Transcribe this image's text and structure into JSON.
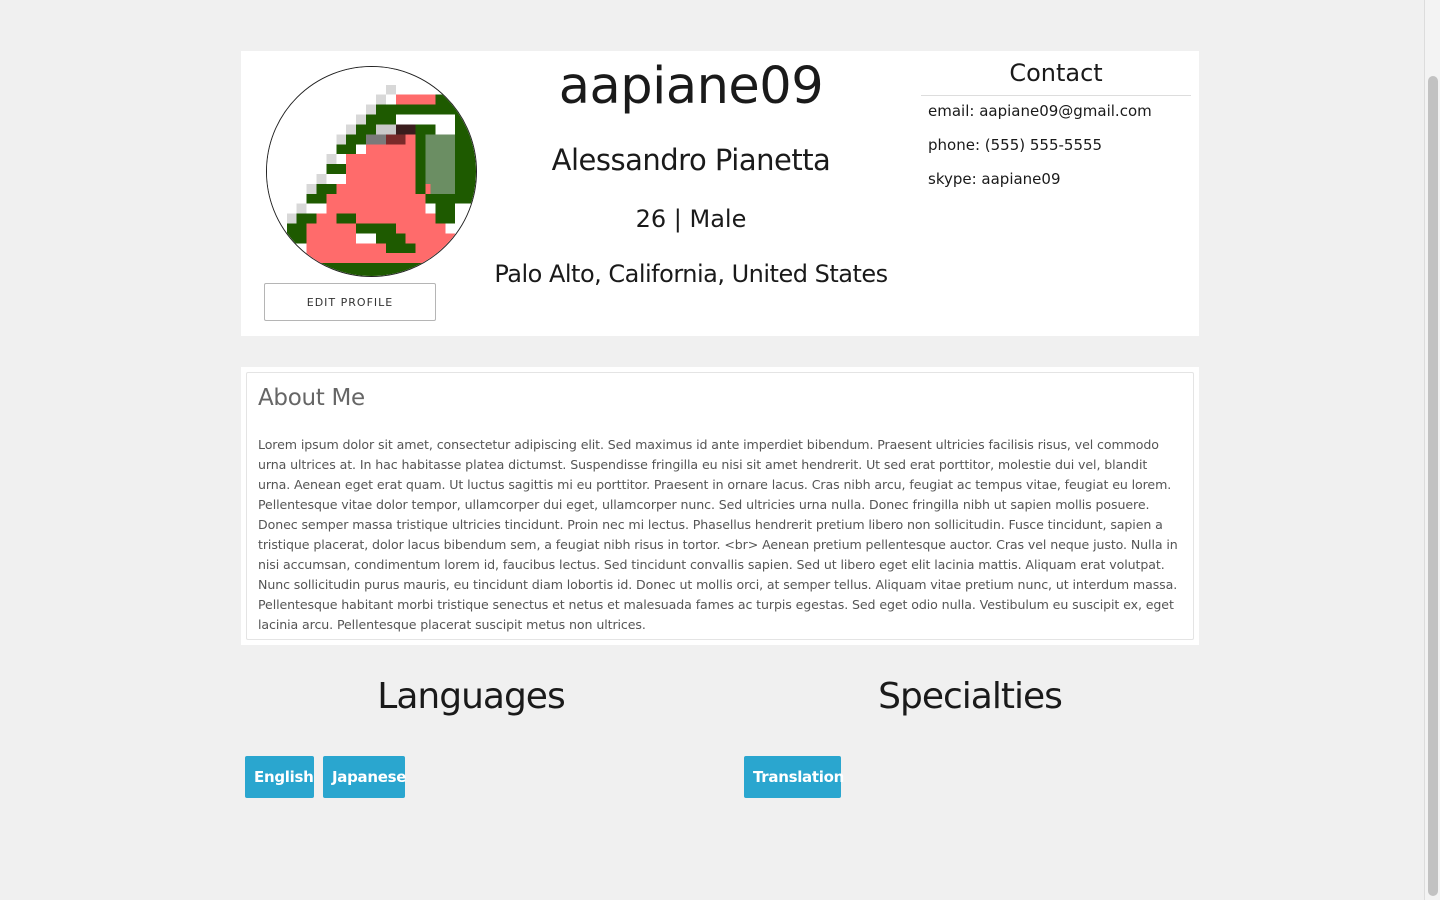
{
  "profile": {
    "username": "aapiane09",
    "full_name": "Alessandro Pianetta",
    "age_sex": "26 | Male",
    "location": "Palo Alto, California, United States",
    "edit_button": "EDIT PROFILE",
    "avatar_icon": "pixel-bird-avatar"
  },
  "contact": {
    "title": "Contact",
    "email": "email: aapiane09@gmail.com",
    "phone": "phone: (555) 555-5555",
    "skype": "skype: aapiane09"
  },
  "about": {
    "title": "About Me",
    "text": "Lorem ipsum dolor sit amet, consectetur adipiscing elit. Sed maximus id ante imperdiet bibendum. Praesent ultricies facilisis risus, vel commodo urna ultrices at. In hac habitasse platea dictumst. Suspendisse fringilla eu nisi sit amet hendrerit. Ut sed erat porttitor, molestie dui vel, blandit urna. Aenean eget erat quam. Ut luctus sagittis mi eu porttitor. Praesent in ornare lacus. Cras nibh arcu, feugiat ac tempus vitae, feugiat eu lorem. Pellentesque vitae dolor tempor, ullamcorper dui eget, ullamcorper nunc. Sed ultricies urna nulla. Donec fringilla nibh ut sapien mollis posuere. Donec semper massa tristique ultricies tincidunt. Proin nec mi lectus. Phasellus hendrerit pretium libero non sollicitudin. Fusce tincidunt, sapien a tristique placerat, dolor lacus bibendum sem, a feugiat nibh risus in tortor. <br> Aenean pretium pellentesque auctor. Cras vel neque justo. Nulla in nisi accumsan, condimentum lorem id, faucibus lectus. Sed tincidunt convallis sapien. Sed ut libero eget elit lacinia mattis. Aliquam erat volutpat. Nunc sollicitudin purus mauris, eu tincidunt diam lobortis id. Donec ut mollis orci, at semper tellus. Aliquam vitae pretium nunc, ut interdum massa. Pellentesque habitant morbi tristique senectus et netus et malesuada fames ac turpis egestas. Sed eget odio nulla. Vestibulum eu suscipit ex, eget lacinia arcu. Pellentesque placerat suscipit metus non ultrices."
  },
  "languages": {
    "title": "Languages",
    "items": [
      "English",
      "Japanese"
    ]
  },
  "specialties": {
    "title": "Specialties",
    "items": [
      "Translation"
    ]
  },
  "colors": {
    "page_background": "#f0f0f0",
    "card_background": "#ffffff",
    "tag_background": "#2aa6cf",
    "avatar_red": "#ff6b6b",
    "avatar_dark_green": "#1e5a00",
    "avatar_light_green": "#6b8e63"
  }
}
